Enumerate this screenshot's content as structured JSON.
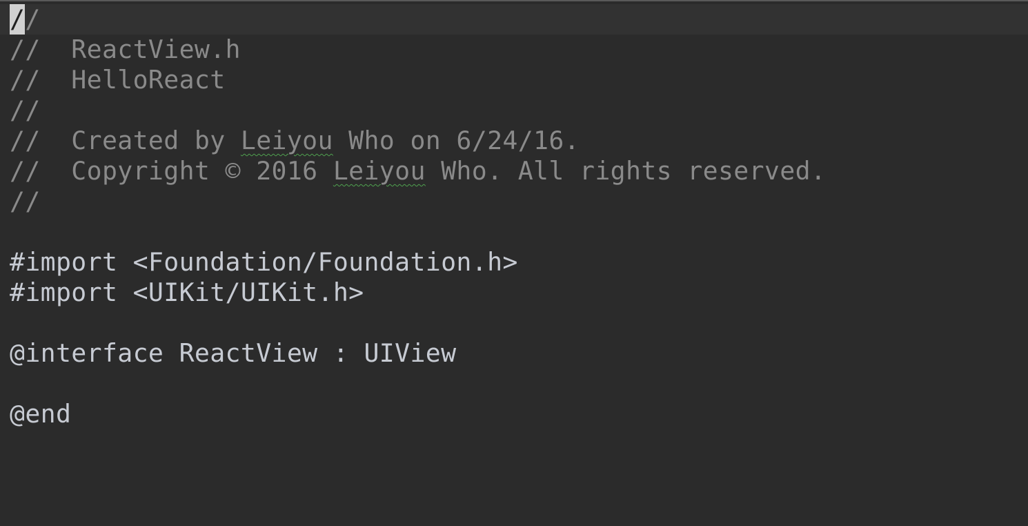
{
  "editor": {
    "lines": [
      {
        "prefix": "",
        "cursor_char": "/",
        "text": "/"
      },
      {
        "text": "//  ReactView.h"
      },
      {
        "text": "//  HelloReact"
      },
      {
        "text": "//"
      },
      {
        "before": "//  Created by ",
        "misspelled": "Leiyou",
        "after": " Who on 6/24/16."
      },
      {
        "before": "//  Copyright © 2016 ",
        "misspelled": "Leiyou",
        "after": " Who. All rights reserved."
      },
      {
        "text": "//"
      },
      {
        "text": ""
      },
      {
        "text": "#import <Foundation/Foundation.h>"
      },
      {
        "text": "#import <UIKit/UIKit.h>"
      },
      {
        "text": ""
      },
      {
        "text": "@interface ReactView : UIView"
      },
      {
        "text": ""
      },
      {
        "text": "@end"
      }
    ]
  },
  "colors": {
    "background": "#2b2b2b",
    "current_line": "#323232",
    "comment": "#8a8a8a",
    "code": "#c7cbd3",
    "spelling_underline": "#4fa24f"
  }
}
